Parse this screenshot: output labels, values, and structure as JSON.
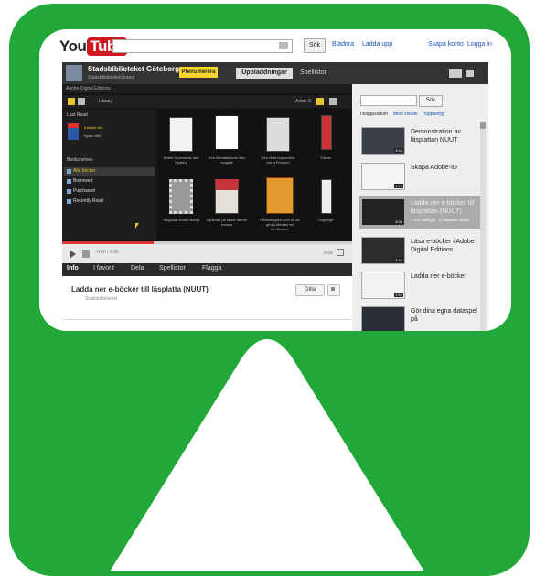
{
  "colors": {
    "frame_green": "#22a838",
    "brand_red": "#cc181e",
    "link_blue": "#1a4fb6",
    "subscribe_yellow": "#f7d52b"
  },
  "header": {
    "logo_you": "You",
    "logo_tube": "Tube",
    "search_button": "Sök",
    "links": [
      "Bläddra",
      "Ladda upp",
      "Skapa konto",
      "Logga in"
    ]
  },
  "channel": {
    "title": "Stadsbiblioteket Göteborg",
    "subtitle": "Stadsbibliotekets kanal",
    "subscribe_label": "Prenumerera",
    "uploads_tab": "Uppladdningar",
    "playlists_tab": "Spellistor"
  },
  "player": {
    "app_title": "Adobe Digital Editions",
    "library_label": "Library",
    "show_label": "Antal: 3",
    "last_read_header": "Last Read",
    "last_read_items": [
      "Kallade sikt",
      "Nyare titel"
    ],
    "bookshelves_header": "Bookshelves",
    "shelves": [
      "Alla böcker",
      "Borrowed",
      "Purchased",
      "Recently Read"
    ],
    "books": [
      {
        "caption": "Kristin Sjoerwerik den Sjoberg",
        "icon": "book-cover-white"
      },
      {
        "caption": "Den Mentalitetens liten sorgfall",
        "icon": "book-cover-white"
      },
      {
        "caption": "Den rätta hopproden Anna Persson",
        "icon": "book-cover-grey"
      },
      {
        "caption": "Tärnet",
        "icon": "book-cover-red"
      },
      {
        "caption": "Tangobar Kristin Bengt",
        "icon": "book-cover-pattern"
      },
      {
        "caption": "Mjukdatt på fästet danne meson",
        "icon": "book-cover-red"
      },
      {
        "caption": "Hesselsigden som en av geom Meddel vid berättelsen",
        "icon": "book-cover-orange"
      },
      {
        "caption": "Tingvinge",
        "icon": "book-cover-white"
      }
    ],
    "time": "0:00 / 3:36",
    "quality": "360p"
  },
  "actions": [
    "Info",
    "I favorit",
    "Dela",
    "Spellistor",
    "Flagga"
  ],
  "video": {
    "title": "Ladda ner e-böcker till läsplatta (NUUT)",
    "uploader": "Stadsbiblioteket",
    "like_label": "Gilla"
  },
  "sidebar": {
    "search_button": "Sök",
    "sort_label": "Tilläggsdatum",
    "sort_links": [
      "Mest visade",
      "Toppbetyg"
    ],
    "items": [
      {
        "title": "Demonstration av läsplattan NUUT",
        "duration": "3:26",
        "meta": "",
        "thumb": "thumb-video-dark"
      },
      {
        "title": "Skapa Adobe-ID",
        "duration": "4:19",
        "meta": "",
        "thumb": "thumb-video-light"
      },
      {
        "title": "Ladda ner e-böcker till läsplattan (NUUT)",
        "duration": "3:36",
        "meta": "1 330 visningar · 11 månader sedan",
        "thumb": "thumb-video-library"
      },
      {
        "title": "Läsa e-böcker i Adobe Digital Editions",
        "duration": "3:26",
        "meta": "",
        "thumb": "thumb-video-library"
      },
      {
        "title": "Ladda ner e-böcker",
        "duration": "1:56",
        "meta": "",
        "thumb": "thumb-video-light"
      },
      {
        "title": "Gör dina egna dataspel på",
        "duration": "",
        "meta": "",
        "thumb": "thumb-video-dark"
      }
    ]
  }
}
